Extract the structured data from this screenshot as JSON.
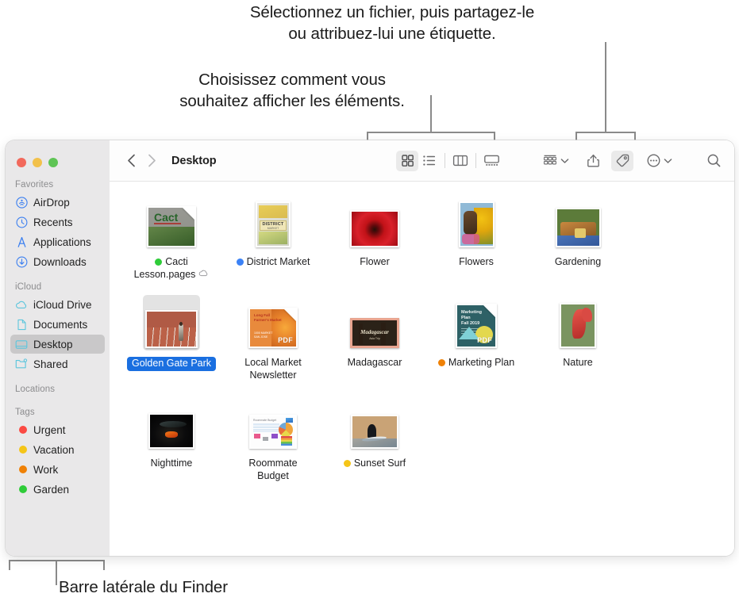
{
  "callouts": {
    "top": "Sélectionnez un fichier, puis partagez-le\nou attribuez-lui une étiquette.",
    "left": "Choisissez comment vous\nsouhaitez afficher les éléments.",
    "bottom": "Barre latérale du Finder"
  },
  "window": {
    "traffic_lights": [
      "close",
      "minimize",
      "zoom"
    ],
    "colors": {
      "close": "#f2695c",
      "minimize": "#f2c14b",
      "zoom": "#5fc455",
      "selection_blue": "#1a6fe0",
      "sidebar_bg": "#e9e8e9",
      "sidebar_selected": "#c9c8c9",
      "sidebar_icon_blue": "#3b7ff0",
      "sidebar_icon_teal": "#59c3d8"
    }
  },
  "toolbar": {
    "back_label": "Précédent",
    "forward_label": "Suivant",
    "path_title": "Desktop",
    "view_buttons": [
      {
        "name": "icon-view",
        "label": "Icônes",
        "active": true
      },
      {
        "name": "list-view",
        "label": "Liste",
        "active": false
      },
      {
        "name": "column-view",
        "label": "Colonnes",
        "active": false
      },
      {
        "name": "gallery-view",
        "label": "Galerie",
        "active": false
      }
    ],
    "action_buttons": [
      {
        "name": "group-by",
        "label": "Grouper",
        "active": false,
        "has_chevron": true
      },
      {
        "name": "share",
        "label": "Partager",
        "active": false,
        "has_chevron": false
      },
      {
        "name": "tag",
        "label": "Étiquettes",
        "active": true,
        "has_chevron": false
      },
      {
        "name": "more",
        "label": "Plus",
        "active": false,
        "has_chevron": true
      }
    ],
    "search_label": "Rechercher"
  },
  "sidebar": {
    "sections": [
      {
        "title": "Favorites",
        "items": [
          {
            "label": "AirDrop",
            "icon": "airdrop-icon",
            "selected": false
          },
          {
            "label": "Recents",
            "icon": "clock-icon",
            "selected": false
          },
          {
            "label": "Applications",
            "icon": "applications-icon",
            "selected": false
          },
          {
            "label": "Downloads",
            "icon": "download-icon",
            "selected": false
          }
        ]
      },
      {
        "title": "iCloud",
        "items": [
          {
            "label": "iCloud Drive",
            "icon": "cloud-icon",
            "selected": false
          },
          {
            "label": "Documents",
            "icon": "document-icon",
            "selected": false
          },
          {
            "label": "Desktop",
            "icon": "desktop-icon",
            "selected": true
          },
          {
            "label": "Shared",
            "icon": "shared-folder-icon",
            "selected": false
          }
        ]
      },
      {
        "title": "Locations",
        "items": []
      },
      {
        "title": "Tags",
        "items": [
          {
            "label": "Urgent",
            "icon": "tag-dot",
            "color": "#fb4a43",
            "selected": false
          },
          {
            "label": "Vacation",
            "icon": "tag-dot",
            "color": "#f5c518",
            "selected": false
          },
          {
            "label": "Work",
            "icon": "tag-dot",
            "color": "#ef8106",
            "selected": false
          },
          {
            "label": "Garden",
            "icon": "tag-dot",
            "color": "#2fcc39",
            "selected": false
          }
        ]
      }
    ]
  },
  "files": [
    {
      "name": "Cacti\nLesson.pages",
      "kind": "pages-document",
      "tag_color": "#2fcc39",
      "cloud": true,
      "selected": false
    },
    {
      "name": "District Market",
      "kind": "image",
      "tag_color": "#3b82f6",
      "cloud": false,
      "selected": false
    },
    {
      "name": "Flower",
      "kind": "image",
      "tag_color": null,
      "cloud": false,
      "selected": false
    },
    {
      "name": "Flowers",
      "kind": "image",
      "tag_color": null,
      "cloud": false,
      "selected": false
    },
    {
      "name": "Gardening",
      "kind": "image",
      "tag_color": null,
      "cloud": false,
      "selected": false
    },
    {
      "name": "Golden Gate Park",
      "kind": "image",
      "tag_color": null,
      "cloud": false,
      "selected": true
    },
    {
      "name": "Local Market\nNewsletter",
      "kind": "pdf-document",
      "tag_color": null,
      "cloud": false,
      "selected": false
    },
    {
      "name": "Madagascar",
      "kind": "image",
      "tag_color": null,
      "cloud": false,
      "selected": false
    },
    {
      "name": "Marketing Plan",
      "kind": "pdf-document",
      "tag_color": "#ef8106",
      "cloud": false,
      "selected": false
    },
    {
      "name": "Nature",
      "kind": "image",
      "tag_color": null,
      "cloud": false,
      "selected": false
    },
    {
      "name": "Nighttime",
      "kind": "image",
      "tag_color": null,
      "cloud": false,
      "selected": false
    },
    {
      "name": "Roommate\nBudget",
      "kind": "numbers-document",
      "tag_color": null,
      "cloud": false,
      "selected": false
    },
    {
      "name": "Sunset Surf",
      "kind": "image",
      "tag_color": "#f5c518",
      "cloud": false,
      "selected": false
    }
  ]
}
